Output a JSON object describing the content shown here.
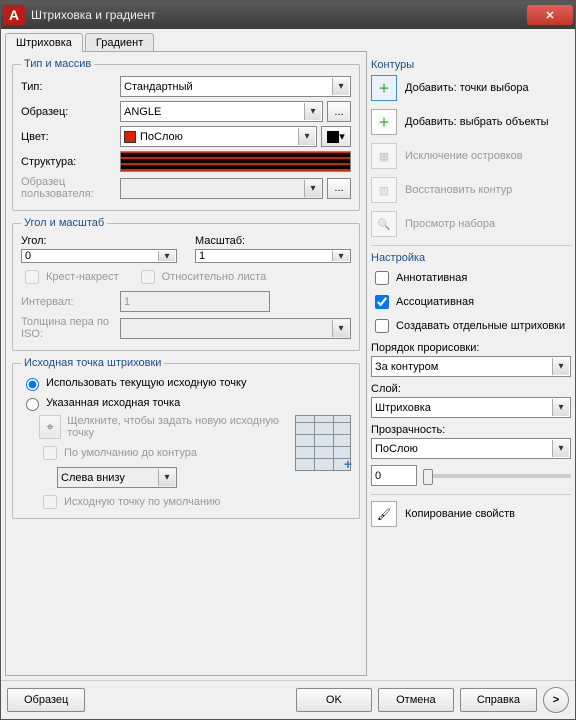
{
  "window": {
    "title": "Штриховка и градиент"
  },
  "tabs": {
    "hatch": "Штриховка",
    "gradient": "Градиент"
  },
  "groups": {
    "type_array": "Тип и массив",
    "angle_scale": "Угол и масштаб",
    "origin": "Исходная точка штриховки",
    "boundaries": "Контуры",
    "options": "Настройка"
  },
  "type_array": {
    "type_lbl": "Тип:",
    "type_val": "Стандартный",
    "pattern_lbl": "Образец:",
    "pattern_val": "ANGLE",
    "color_lbl": "Цвет:",
    "color_val": "ПоСлою",
    "struct_lbl": "Структура:",
    "custom_lbl": "Образец пользователя:",
    "dots": "..."
  },
  "angle_scale": {
    "angle_lbl": "Угол:",
    "angle_val": "0",
    "scale_lbl": "Масштаб:",
    "scale_val": "1",
    "double_lbl": "Крест-накрест",
    "paper_lbl": "Относительно листа",
    "spacing_lbl": "Интервал:",
    "spacing_val": "1",
    "iso_lbl": "Толщина пера по ISO:"
  },
  "origin": {
    "use_current": "Использовать текущую исходную точку",
    "specified": "Указанная исходная точка",
    "click_hint": "Щелкните, чтобы задать новую исходную точку",
    "default_bounds": "По умолчанию до контура",
    "pos_val": "Слева внизу",
    "store_default": "Исходную точку по умолчанию"
  },
  "boundaries": {
    "add_points": "Добавить: точки выбора",
    "add_objects": "Добавить: выбрать объекты",
    "remove_islands": "Исключение островков",
    "recreate": "Восстановить контур",
    "view_sel": "Просмотр набора"
  },
  "options": {
    "annotative": "Аннотативная",
    "associative": "Ассоциативная",
    "separate": "Создавать отдельные штриховки",
    "draw_order_lbl": "Порядок прорисовки:",
    "draw_order_val": "За контуром",
    "layer_lbl": "Слой:",
    "layer_val": "Штриховка",
    "trans_lbl": "Прозрачность:",
    "trans_val": "ПоСлою",
    "trans_num": "0",
    "inherit": "Копирование свойств"
  },
  "footer": {
    "preview": "Образец",
    "ok": "OK",
    "cancel": "Отмена",
    "help": "Справка",
    "more": ">"
  }
}
